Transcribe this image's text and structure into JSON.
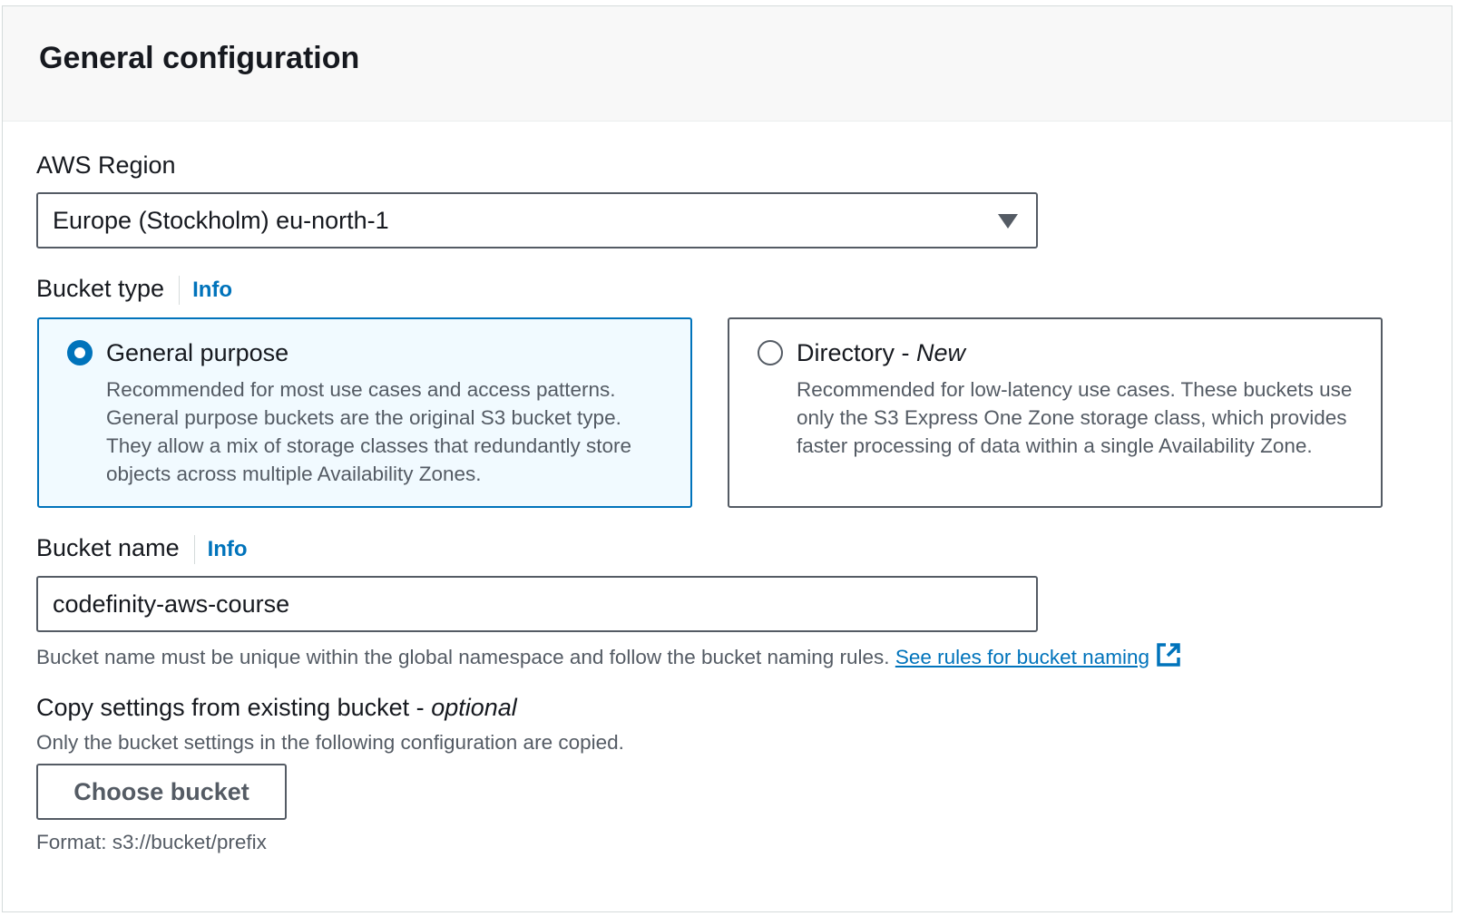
{
  "header": {
    "title": "General configuration"
  },
  "region": {
    "label": "AWS Region",
    "selected": "Europe (Stockholm) eu-north-1"
  },
  "bucket_type": {
    "label": "Bucket type",
    "info": "Info",
    "options": [
      {
        "title": "General purpose",
        "title_suffix": "",
        "selected": true,
        "description": "Recommended for most use cases and access patterns. General purpose buckets are the original S3 bucket type. They allow a mix of storage classes that redundantly store objects across multiple Availability Zones."
      },
      {
        "title": "Directory - ",
        "title_suffix": "New",
        "selected": false,
        "description": "Recommended for low-latency use cases. These buckets use only the S3 Express One Zone storage class, which provides faster processing of data within a single Availability Zone."
      }
    ]
  },
  "bucket_name": {
    "label": "Bucket name",
    "info": "Info",
    "value": "codefinity-aws-course",
    "hint": "Bucket name must be unique within the global namespace and follow the bucket naming rules.",
    "link": "See rules for bucket naming"
  },
  "copy_settings": {
    "label": "Copy settings from existing bucket - ",
    "label_suffix": "optional",
    "description": "Only the bucket settings in the following configuration are copied.",
    "button": "Choose bucket",
    "format": "Format: s3://bucket/prefix"
  },
  "colors": {
    "accent": "#0073bb",
    "text": "#16191f",
    "secondary_text": "#545b64",
    "selected_tile_bg": "#f1faff"
  }
}
